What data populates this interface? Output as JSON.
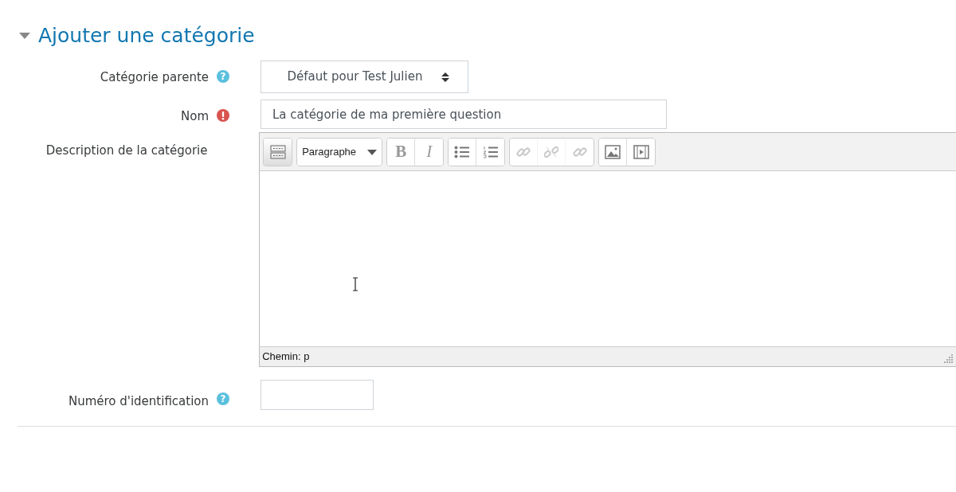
{
  "section": {
    "title": "Ajouter une catégorie",
    "expanded": true
  },
  "fields": [
    {
      "kind": "select",
      "label": "Catégorie parente",
      "help": "?",
      "required": false,
      "value": "Défaut pour Test Julien"
    },
    {
      "kind": "text",
      "label": "Nom",
      "required": true,
      "value": "La catégorie de ma première question"
    },
    {
      "kind": "editor",
      "label": "Description de la catégorie",
      "required": false,
      "format": "Paragraphe",
      "path": "Chemin: p",
      "toolbar": [
        [
          {
            "kind": "more",
            "disabled": false,
            "active": true
          }
        ],
        [
          {
            "kind": "format",
            "disabled": false,
            "active": false
          }
        ],
        [
          {
            "kind": "bold",
            "label": "B",
            "disabled": false,
            "active": false
          },
          {
            "kind": "italic",
            "label": "I",
            "disabled": false,
            "active": false
          }
        ],
        [
          {
            "kind": "bullets",
            "disabled": false,
            "active": false
          },
          {
            "kind": "numbers",
            "disabled": false,
            "active": false
          }
        ],
        [
          {
            "kind": "link",
            "disabled": true,
            "active": false
          },
          {
            "kind": "unlink",
            "disabled": true,
            "active": false
          },
          {
            "kind": "link",
            "disabled": true,
            "active": false
          }
        ],
        [
          {
            "kind": "image",
            "disabled": false,
            "active": false
          },
          {
            "kind": "media",
            "disabled": false,
            "active": false
          }
        ]
      ]
    },
    {
      "kind": "short",
      "label": "Numéro d'identification",
      "help": "?",
      "required": false
    }
  ]
}
